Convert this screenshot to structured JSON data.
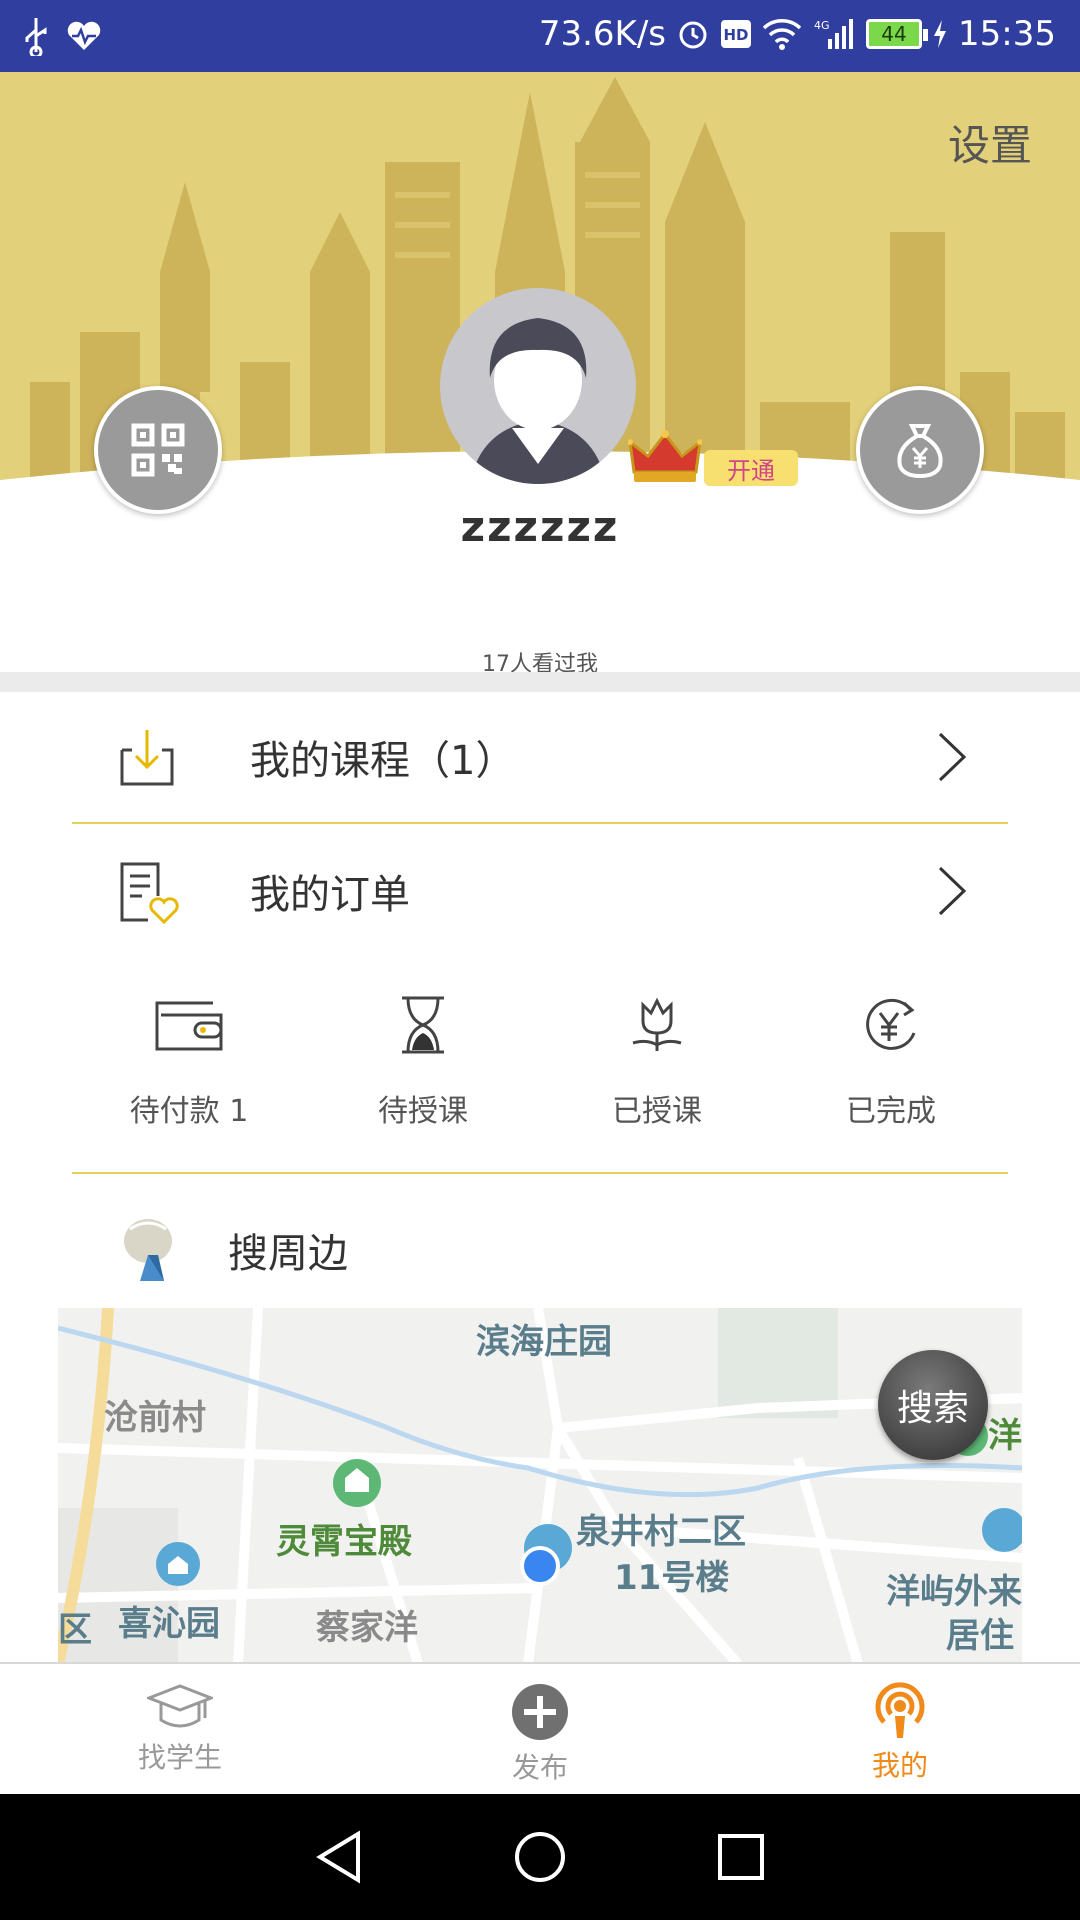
{
  "status_bar": {
    "speed": "73.6K/s",
    "network": "4G",
    "battery": "44",
    "time": "15:35"
  },
  "header": {
    "settings_label": "设置",
    "username": "zzzzzz",
    "vip_badge": "开通",
    "viewed_text": "17人看过我"
  },
  "menu": {
    "courses_label": "我的课程（1）",
    "orders_label": "我的订单"
  },
  "order_status": [
    {
      "label": "待付款 1",
      "icon": "wallet-icon"
    },
    {
      "label": "待授课",
      "icon": "hourglass-icon"
    },
    {
      "label": "已授课",
      "icon": "flower-icon"
    },
    {
      "label": "已完成",
      "icon": "yen-refresh-icon"
    }
  ],
  "nearby": {
    "label": "搜周边",
    "search_button": "搜索",
    "map_places": [
      "滨海庄园",
      "沧前村",
      "灵霄宝殿",
      "泉井村二区",
      "11号楼",
      "喜沁园",
      "蔡家洋",
      "洋屿外来",
      "居住",
      "洋",
      "区"
    ]
  },
  "tabbar": {
    "tabs": [
      {
        "label": "找学生",
        "icon": "graduation-cap-icon"
      },
      {
        "label": "发布",
        "icon": "plus-circle-icon"
      },
      {
        "label": "我的",
        "icon": "podcast-icon"
      }
    ],
    "active_color": "#f08a1a"
  },
  "colors": {
    "status_bar": "#303f9f",
    "header_bg": "#e3d07a",
    "divider": "#e6cf5b"
  }
}
